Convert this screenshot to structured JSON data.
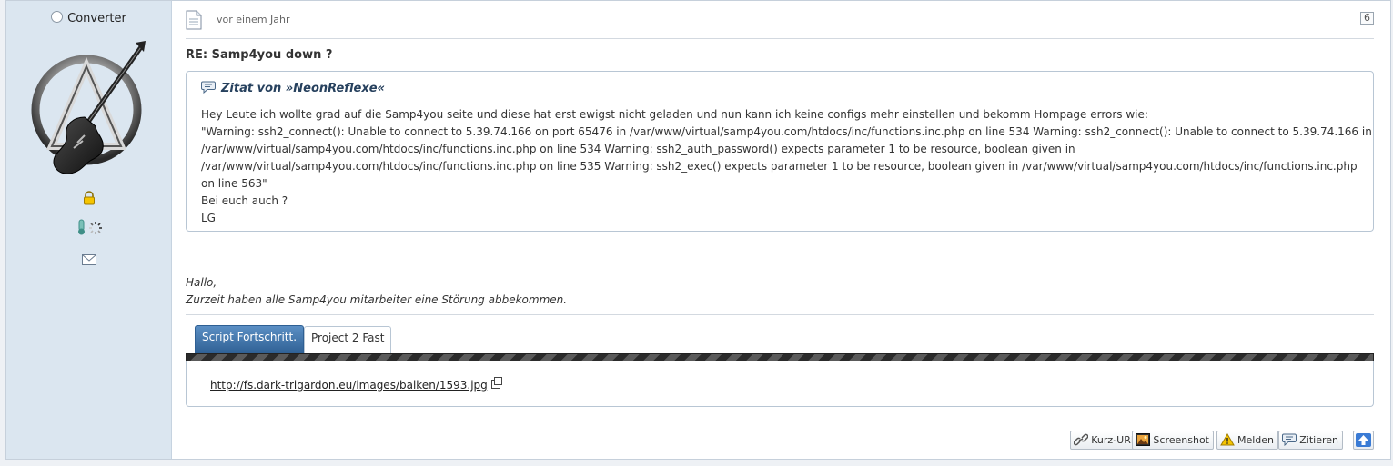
{
  "user": {
    "name": "Converter"
  },
  "post": {
    "time": "vor einem Jahr",
    "number": "6",
    "title": "RE: Samp4you down ?"
  },
  "quote": {
    "header": "Zitat von »NeonReflexe«",
    "lines": [
      "Hey Leute ich wollte grad auf die Samp4you seite und diese hat erst ewigst nicht geladen und nun kann ich keine configs mehr einstellen und bekomm Hompage errors wie:",
      "\"Warning: ssh2_connect(): Unable to connect to 5.39.74.166 on port 65476 in /var/www/virtual/samp4you.com/htdocs/inc/functions.inc.php on line 534 Warning: ssh2_connect(): Unable to connect to 5.39.74.166 in",
      "/var/www/virtual/samp4you.com/htdocs/inc/functions.inc.php on line 534 Warning: ssh2_auth_password() expects parameter 1 to be resource, boolean given in",
      "/var/www/virtual/samp4you.com/htdocs/inc/functions.inc.php on line 535 Warning: ssh2_exec() expects parameter 1 to be resource, boolean given in /var/www/virtual/samp4you.com/htdocs/inc/functions.inc.php",
      "on line 563\"",
      "Bei euch auch ?",
      "LG"
    ]
  },
  "reply": {
    "lines": [
      "Hallo,",
      "Zurzeit haben alle Samp4you mitarbeiter eine Störung abbekommen."
    ]
  },
  "signature_tabs": {
    "tabs": [
      {
        "label": "Script Fortschritt.",
        "active": true
      },
      {
        "label": "Project 2 Fast",
        "active": false
      }
    ],
    "link": "http://fs.dark-trigardon.eu/images/balken/1593.jpg"
  },
  "buttons": {
    "short_url": "Kurz-URL",
    "screenshot": "Screenshot",
    "report": "Melden",
    "quote": "Zitieren"
  }
}
